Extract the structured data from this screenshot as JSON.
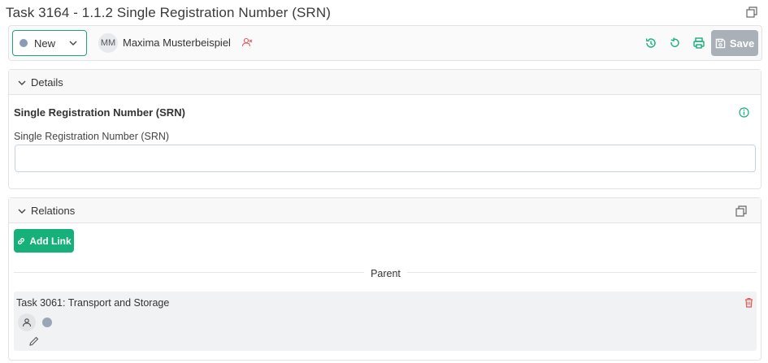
{
  "page": {
    "title": "Task 3164 - 1.1.2 Single Registration Number (SRN)"
  },
  "toolbar": {
    "status": "New",
    "assignee_initials": "MM",
    "assignee_name": "Maxima Musterbeispiel",
    "save_label": "Save"
  },
  "details": {
    "section_title": "Details",
    "field_heading": "Single Registration Number (SRN)",
    "field_label": "Single Registration Number (SRN)",
    "field_value": ""
  },
  "relations": {
    "section_title": "Relations",
    "add_link_label": "Add Link",
    "parent_label": "Parent",
    "items": [
      {
        "title": "Task 3061: Transport and Storage"
      }
    ]
  },
  "icons": {
    "popout": "popout-icon",
    "chevron": "chevron-down-icon",
    "unassign": "user-remove-icon",
    "history": "history-icon",
    "reset": "undo-icon",
    "print": "printer-icon",
    "save": "save-icon",
    "info": "info-icon",
    "link": "link-icon",
    "delete": "trash-icon",
    "user": "user-icon",
    "edit": "pencil-icon"
  },
  "colors": {
    "accent_green": "#16b07a",
    "status_gray": "#8a9bb5",
    "save_disabled": "#a9b0b8",
    "danger_red": "#e05555"
  }
}
